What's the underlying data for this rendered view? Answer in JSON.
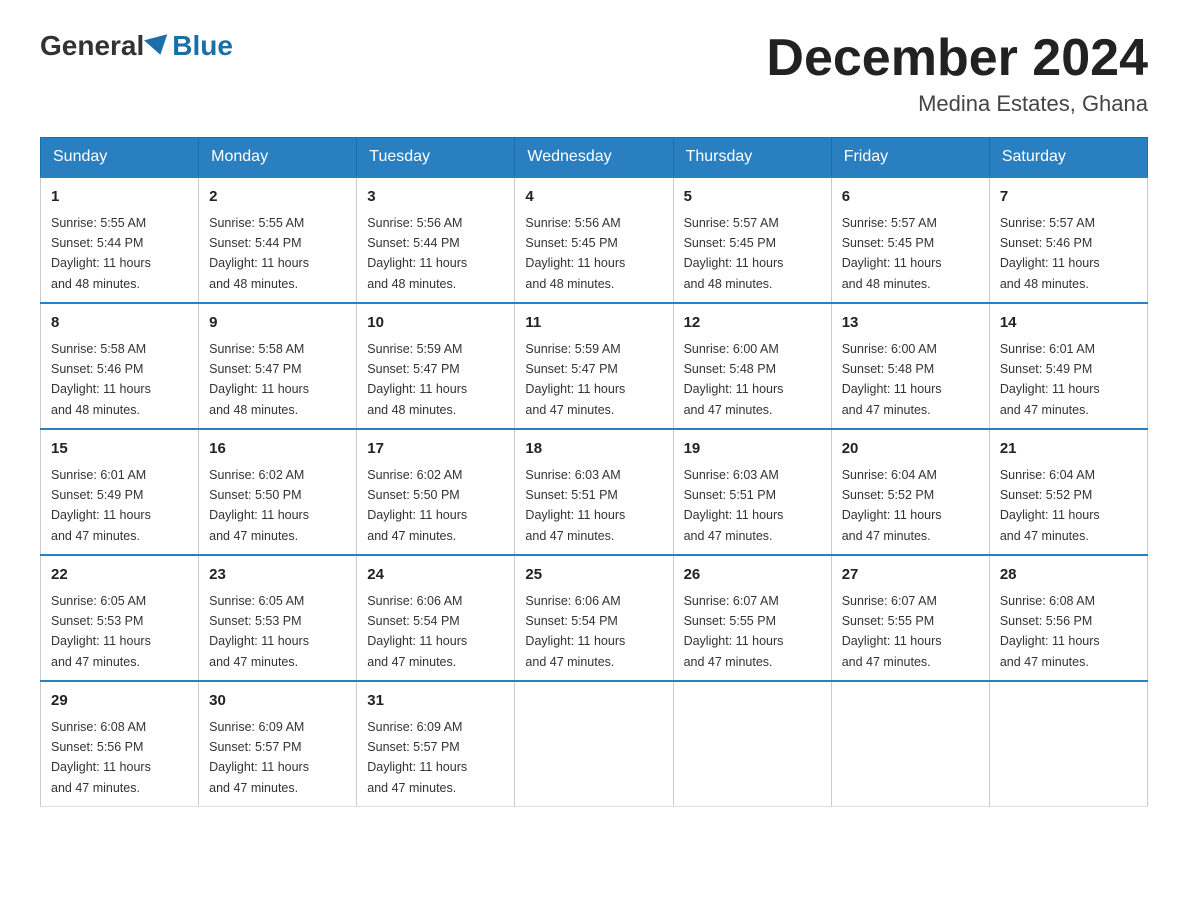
{
  "header": {
    "logo_general": "General",
    "logo_blue": "Blue",
    "month_title": "December 2024",
    "location": "Medina Estates, Ghana"
  },
  "days_of_week": [
    "Sunday",
    "Monday",
    "Tuesday",
    "Wednesday",
    "Thursday",
    "Friday",
    "Saturday"
  ],
  "weeks": [
    [
      {
        "day": "1",
        "sunrise": "5:55 AM",
        "sunset": "5:44 PM",
        "daylight": "11 hours and 48 minutes."
      },
      {
        "day": "2",
        "sunrise": "5:55 AM",
        "sunset": "5:44 PM",
        "daylight": "11 hours and 48 minutes."
      },
      {
        "day": "3",
        "sunrise": "5:56 AM",
        "sunset": "5:44 PM",
        "daylight": "11 hours and 48 minutes."
      },
      {
        "day": "4",
        "sunrise": "5:56 AM",
        "sunset": "5:45 PM",
        "daylight": "11 hours and 48 minutes."
      },
      {
        "day": "5",
        "sunrise": "5:57 AM",
        "sunset": "5:45 PM",
        "daylight": "11 hours and 48 minutes."
      },
      {
        "day": "6",
        "sunrise": "5:57 AM",
        "sunset": "5:45 PM",
        "daylight": "11 hours and 48 minutes."
      },
      {
        "day": "7",
        "sunrise": "5:57 AM",
        "sunset": "5:46 PM",
        "daylight": "11 hours and 48 minutes."
      }
    ],
    [
      {
        "day": "8",
        "sunrise": "5:58 AM",
        "sunset": "5:46 PM",
        "daylight": "11 hours and 48 minutes."
      },
      {
        "day": "9",
        "sunrise": "5:58 AM",
        "sunset": "5:47 PM",
        "daylight": "11 hours and 48 minutes."
      },
      {
        "day": "10",
        "sunrise": "5:59 AM",
        "sunset": "5:47 PM",
        "daylight": "11 hours and 48 minutes."
      },
      {
        "day": "11",
        "sunrise": "5:59 AM",
        "sunset": "5:47 PM",
        "daylight": "11 hours and 47 minutes."
      },
      {
        "day": "12",
        "sunrise": "6:00 AM",
        "sunset": "5:48 PM",
        "daylight": "11 hours and 47 minutes."
      },
      {
        "day": "13",
        "sunrise": "6:00 AM",
        "sunset": "5:48 PM",
        "daylight": "11 hours and 47 minutes."
      },
      {
        "day": "14",
        "sunrise": "6:01 AM",
        "sunset": "5:49 PM",
        "daylight": "11 hours and 47 minutes."
      }
    ],
    [
      {
        "day": "15",
        "sunrise": "6:01 AM",
        "sunset": "5:49 PM",
        "daylight": "11 hours and 47 minutes."
      },
      {
        "day": "16",
        "sunrise": "6:02 AM",
        "sunset": "5:50 PM",
        "daylight": "11 hours and 47 minutes."
      },
      {
        "day": "17",
        "sunrise": "6:02 AM",
        "sunset": "5:50 PM",
        "daylight": "11 hours and 47 minutes."
      },
      {
        "day": "18",
        "sunrise": "6:03 AM",
        "sunset": "5:51 PM",
        "daylight": "11 hours and 47 minutes."
      },
      {
        "day": "19",
        "sunrise": "6:03 AM",
        "sunset": "5:51 PM",
        "daylight": "11 hours and 47 minutes."
      },
      {
        "day": "20",
        "sunrise": "6:04 AM",
        "sunset": "5:52 PM",
        "daylight": "11 hours and 47 minutes."
      },
      {
        "day": "21",
        "sunrise": "6:04 AM",
        "sunset": "5:52 PM",
        "daylight": "11 hours and 47 minutes."
      }
    ],
    [
      {
        "day": "22",
        "sunrise": "6:05 AM",
        "sunset": "5:53 PM",
        "daylight": "11 hours and 47 minutes."
      },
      {
        "day": "23",
        "sunrise": "6:05 AM",
        "sunset": "5:53 PM",
        "daylight": "11 hours and 47 minutes."
      },
      {
        "day": "24",
        "sunrise": "6:06 AM",
        "sunset": "5:54 PM",
        "daylight": "11 hours and 47 minutes."
      },
      {
        "day": "25",
        "sunrise": "6:06 AM",
        "sunset": "5:54 PM",
        "daylight": "11 hours and 47 minutes."
      },
      {
        "day": "26",
        "sunrise": "6:07 AM",
        "sunset": "5:55 PM",
        "daylight": "11 hours and 47 minutes."
      },
      {
        "day": "27",
        "sunrise": "6:07 AM",
        "sunset": "5:55 PM",
        "daylight": "11 hours and 47 minutes."
      },
      {
        "day": "28",
        "sunrise": "6:08 AM",
        "sunset": "5:56 PM",
        "daylight": "11 hours and 47 minutes."
      }
    ],
    [
      {
        "day": "29",
        "sunrise": "6:08 AM",
        "sunset": "5:56 PM",
        "daylight": "11 hours and 47 minutes."
      },
      {
        "day": "30",
        "sunrise": "6:09 AM",
        "sunset": "5:57 PM",
        "daylight": "11 hours and 47 minutes."
      },
      {
        "day": "31",
        "sunrise": "6:09 AM",
        "sunset": "5:57 PM",
        "daylight": "11 hours and 47 minutes."
      },
      null,
      null,
      null,
      null
    ]
  ],
  "labels": {
    "sunrise": "Sunrise:",
    "sunset": "Sunset:",
    "daylight": "Daylight:"
  }
}
